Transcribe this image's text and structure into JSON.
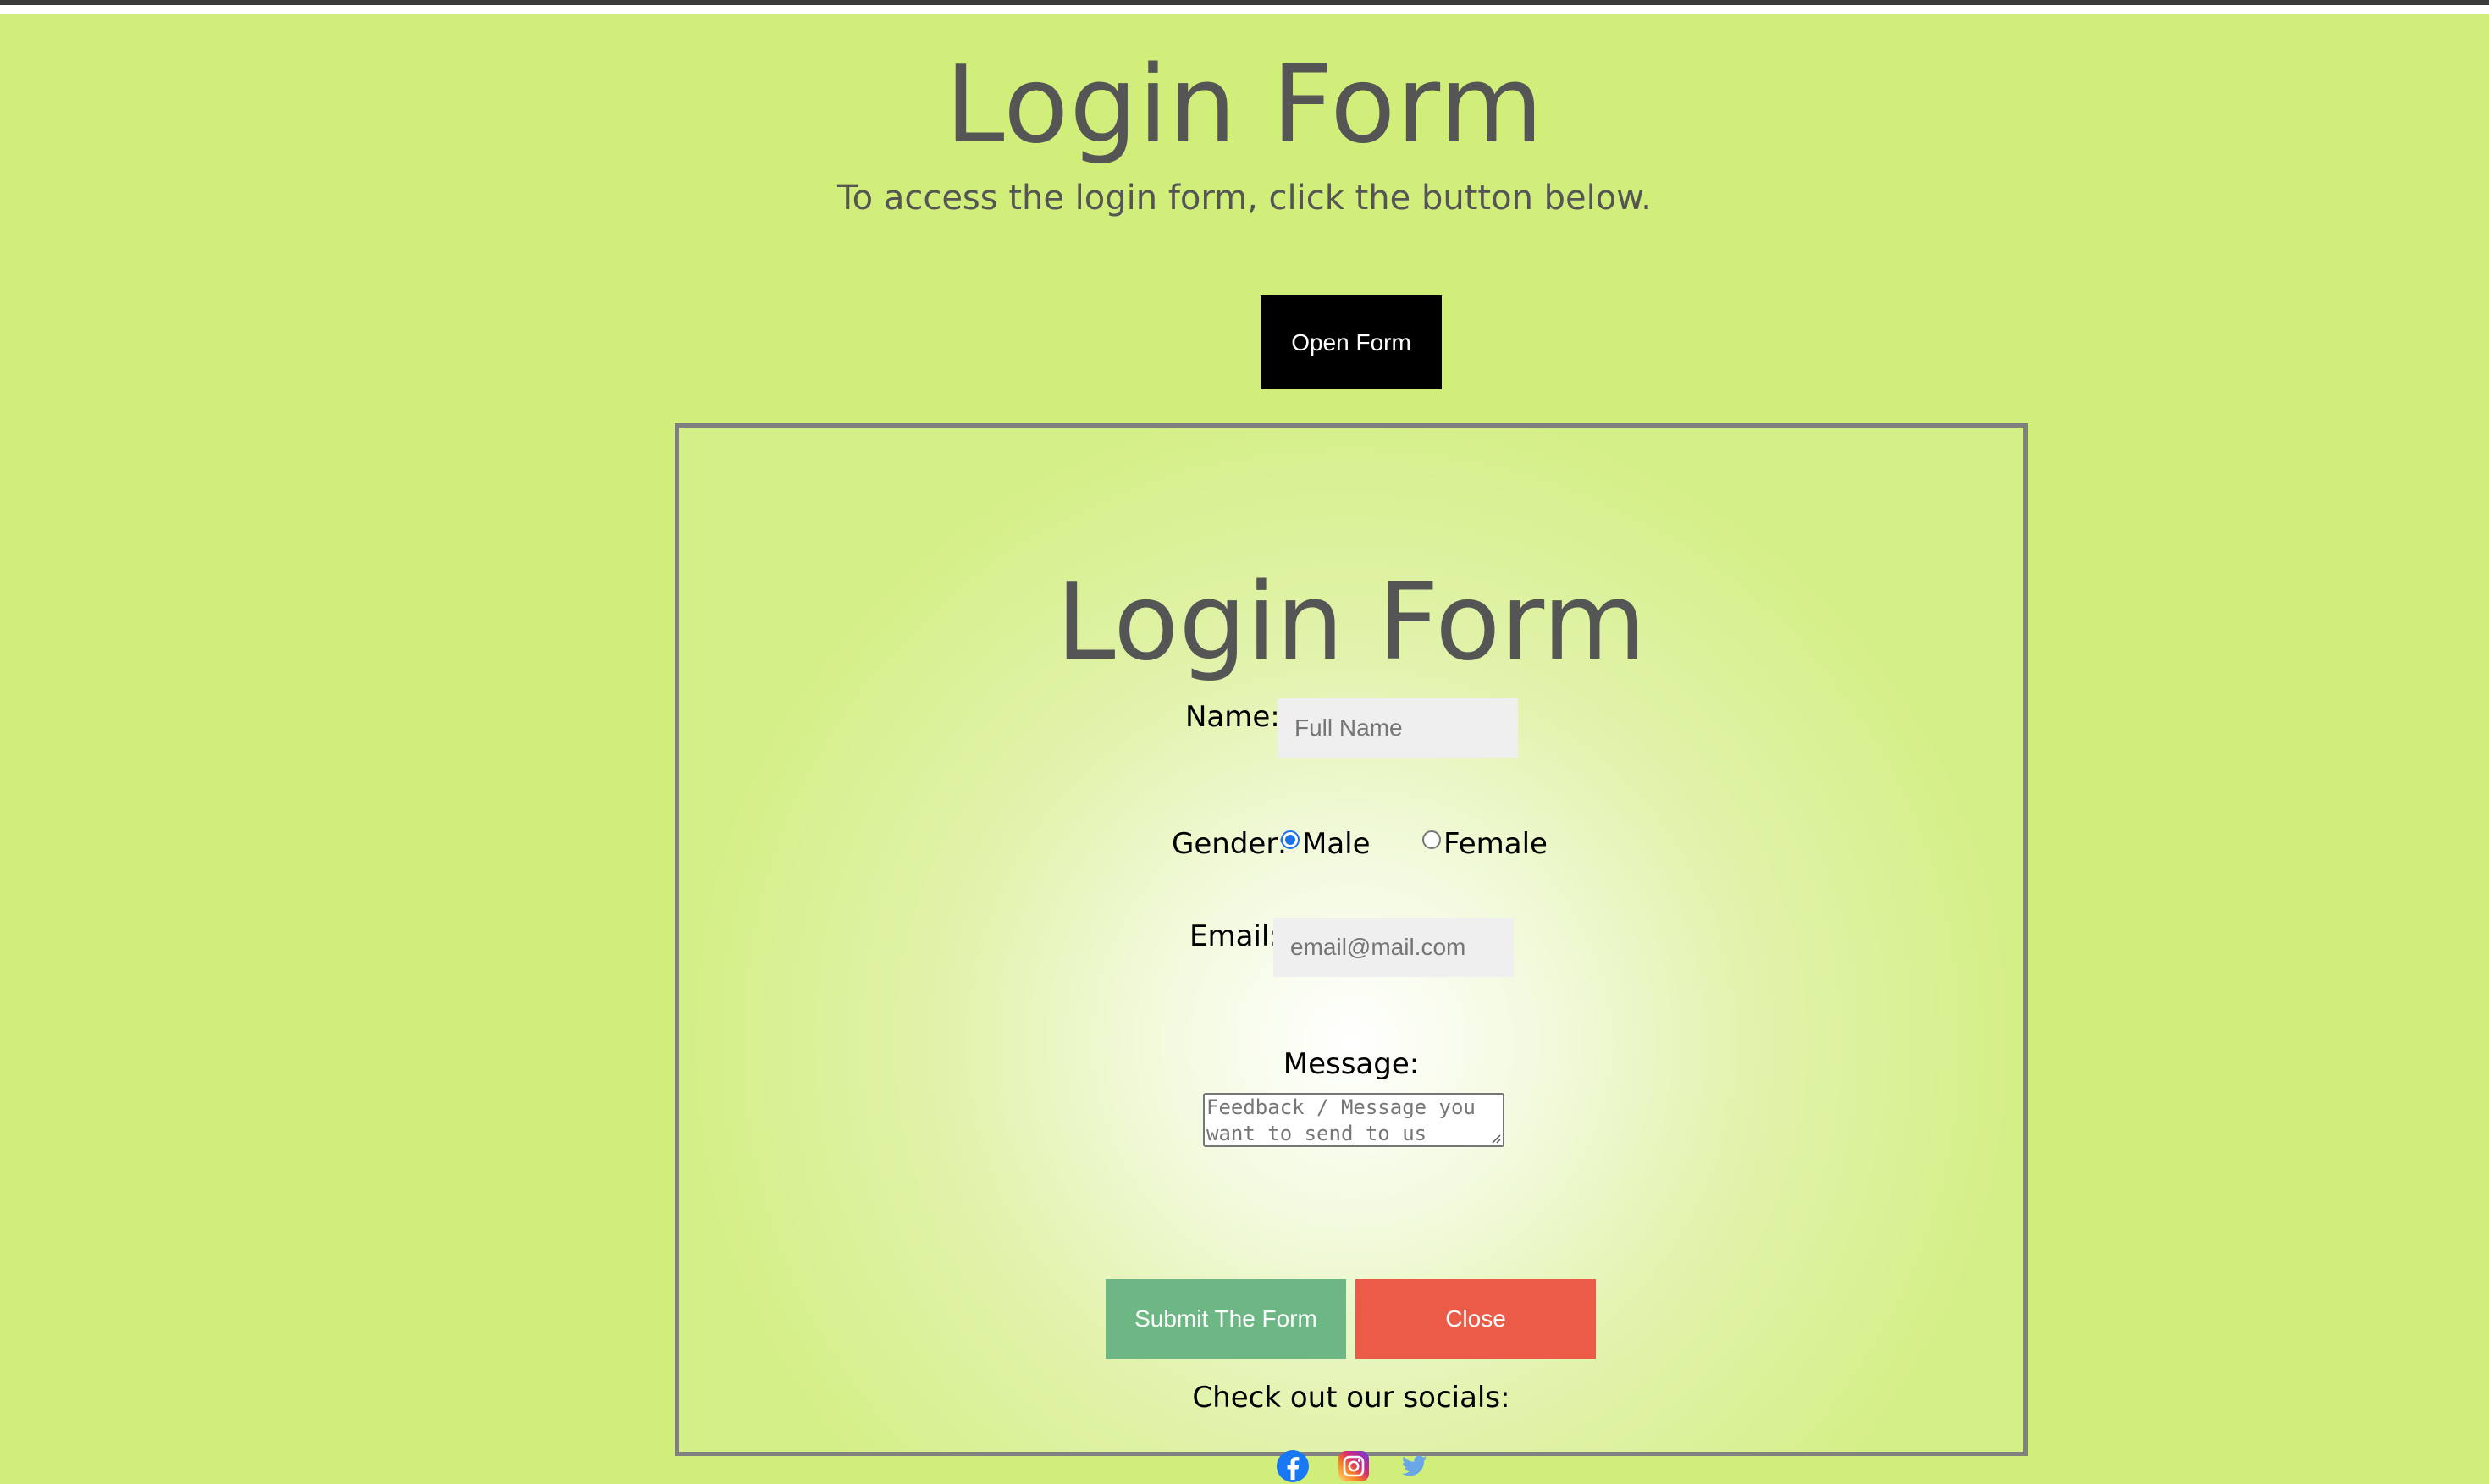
{
  "page": {
    "title": "Login Form",
    "subtitle": "To access the login form, click the button below.",
    "open_button_label": "Open Form"
  },
  "modal": {
    "title": "Login Form",
    "name": {
      "label": "Name:",
      "placeholder": "Full Name",
      "value": ""
    },
    "gender": {
      "label": "Gender:",
      "options": [
        {
          "label": "Male",
          "checked": true
        },
        {
          "label": "Female",
          "checked": false
        }
      ]
    },
    "email": {
      "label": "Email:",
      "placeholder": "email@mail.com",
      "value": ""
    },
    "message": {
      "label": "Message:",
      "placeholder": "Feedback / Message you want to send to us",
      "value": ""
    },
    "submit_label": "Submit The Form",
    "close_label": "Close",
    "socials_label": "Check out our socials:",
    "socials": [
      {
        "icon": "facebook-icon",
        "color": "#1877f2"
      },
      {
        "icon": "instagram-icon",
        "color": "#c13584"
      },
      {
        "icon": "twitter-icon",
        "color": "#6aa7e8"
      }
    ]
  },
  "colors": {
    "background": "#d1ee7a",
    "heading": "#555555",
    "open_button": "#000000",
    "submit_button": "#6cb783",
    "close_button": "#ec5b48",
    "modal_border": "#808080"
  }
}
